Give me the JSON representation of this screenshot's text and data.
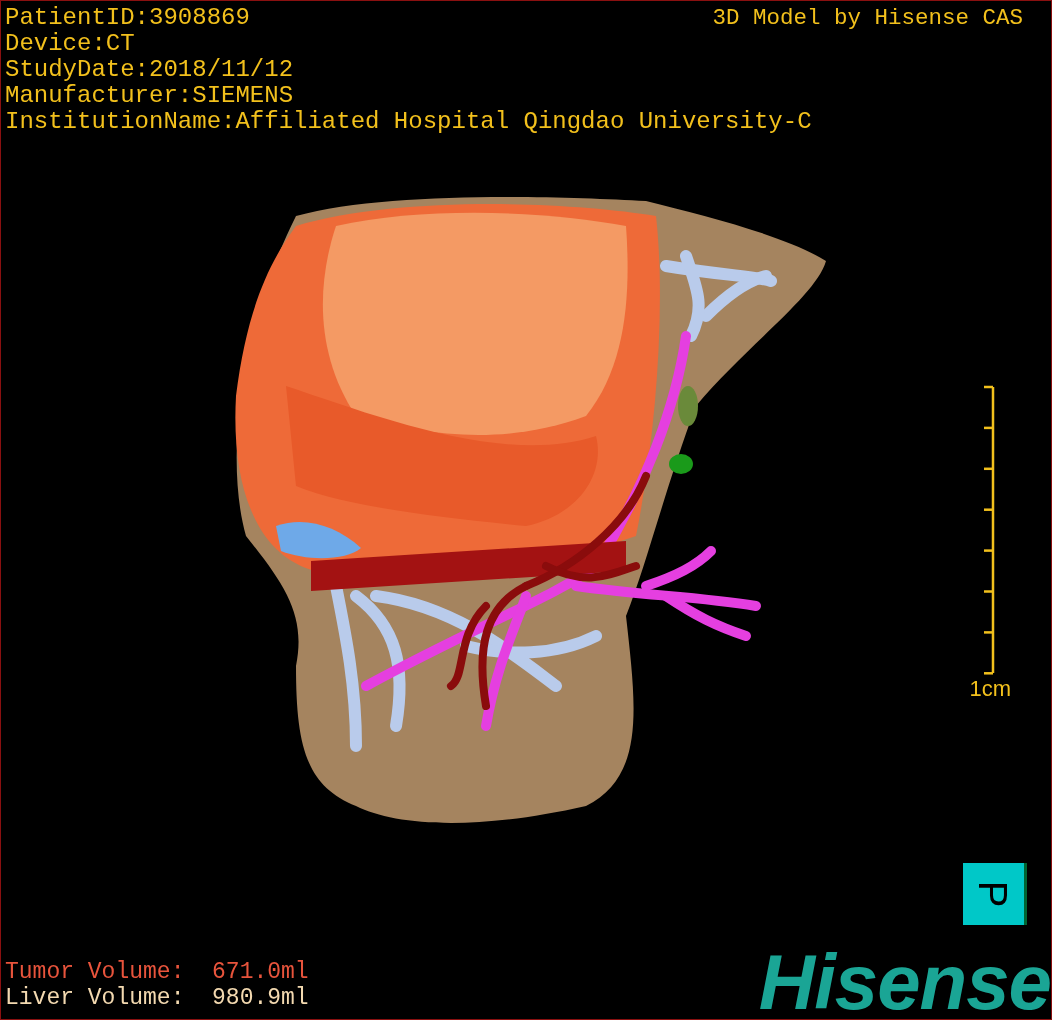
{
  "info_lines": [
    "PatientID:3908869",
    "Device:CT",
    "StudyDate:2018/11/12",
    "Manufacturer:SIEMENS",
    "InstitutionName:Affiliated Hospital Qingdao University-C"
  ],
  "credit": "3D Model by Hisense CAS",
  "scale": {
    "label": "1cm"
  },
  "orientation": {
    "label": "P"
  },
  "volumes": [
    {
      "text": "Tumor Volume:  671.0ml",
      "color": "#e8543c"
    },
    {
      "text": "Liver Volume:  980.9ml",
      "color": "#f3d9b0"
    }
  ],
  "logo": "Hisense"
}
